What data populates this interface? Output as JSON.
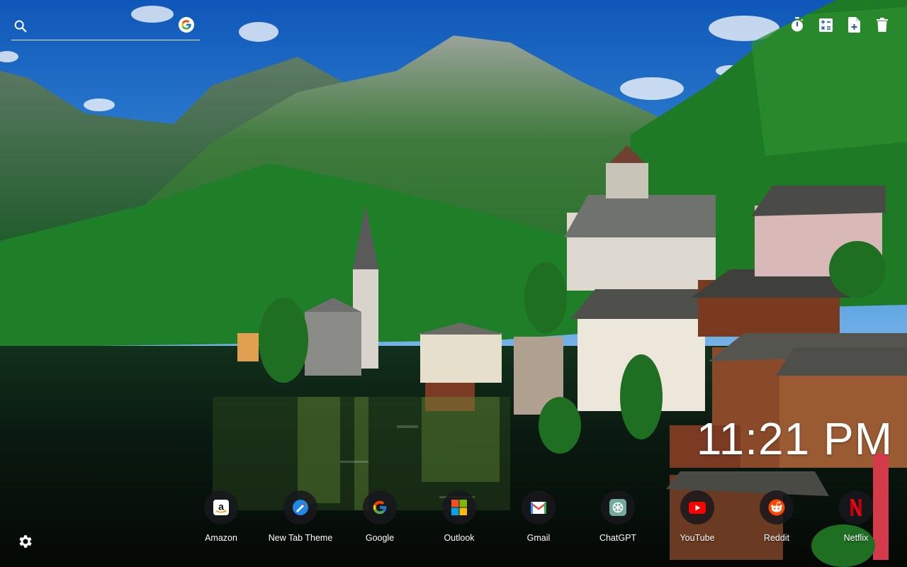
{
  "search": {
    "placeholder": "",
    "engine_icon": "google-icon"
  },
  "toolbar": {
    "items": [
      {
        "icon": "stopwatch-icon"
      },
      {
        "icon": "calculator-icon"
      },
      {
        "icon": "add-document-icon"
      },
      {
        "icon": "trash-icon"
      }
    ]
  },
  "clock": {
    "time": "11:21 PM"
  },
  "shortcuts": [
    {
      "label": "Amazon",
      "icon": "amazon-icon"
    },
    {
      "label": "New Tab Theme",
      "icon": "new-tab-theme-icon"
    },
    {
      "label": "Google",
      "icon": "google-icon"
    },
    {
      "label": "Outlook",
      "icon": "microsoft-icon"
    },
    {
      "label": "Gmail",
      "icon": "gmail-icon"
    },
    {
      "label": "ChatGPT",
      "icon": "chatgpt-icon"
    },
    {
      "label": "YouTube",
      "icon": "youtube-icon"
    },
    {
      "label": "Reddit",
      "icon": "reddit-icon"
    },
    {
      "label": "Netflix",
      "icon": "netflix-icon"
    }
  ],
  "settings": {
    "icon": "gear-icon"
  },
  "colors": {
    "sky": "#1f6fc4",
    "forest": "#1f7a2a",
    "lake": "#0b1410",
    "youtube": "#ff0000",
    "netflix": "#e50914",
    "reddit": "#ff4500"
  }
}
